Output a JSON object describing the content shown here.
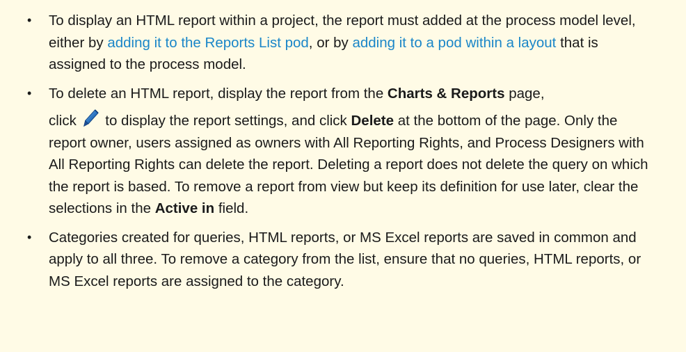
{
  "bullets": [
    {
      "t1": "To display an HTML report within a project, the report must added at the process model level, either by ",
      "link1": "adding it to the Reports List pod",
      "t2": ", or by ",
      "link2": "adding it to a pod within a layout",
      "t3": " that is assigned to the process model."
    },
    {
      "t1": "To delete an HTML report, display the report from the ",
      "b1": "Charts & Reports",
      "t2": " page,",
      "t3": "click ",
      "icon": "pencil-icon",
      "t4": " to display the report settings, and click ",
      "b2": "Delete",
      "t5": " at the bottom of the page. Only the report owner, users assigned as owners with All Reporting Rights, and Process Designers with All Reporting Rights can delete the report. Deleting a report does not delete the query on which the report is based. To remove a report from view but keep its definition for use later, clear the selections in the ",
      "b3": "Active in",
      "t6": " field."
    },
    {
      "t1": "Categories created for queries, HTML reports, or MS Excel reports are saved in common and apply to all three. To remove a category from the list, ensure that no queries, HTML reports, or MS Excel reports are assigned to the category."
    }
  ],
  "colors": {
    "background": "#fffbe6",
    "link": "#1a86c8",
    "text": "#1a1a1a"
  }
}
